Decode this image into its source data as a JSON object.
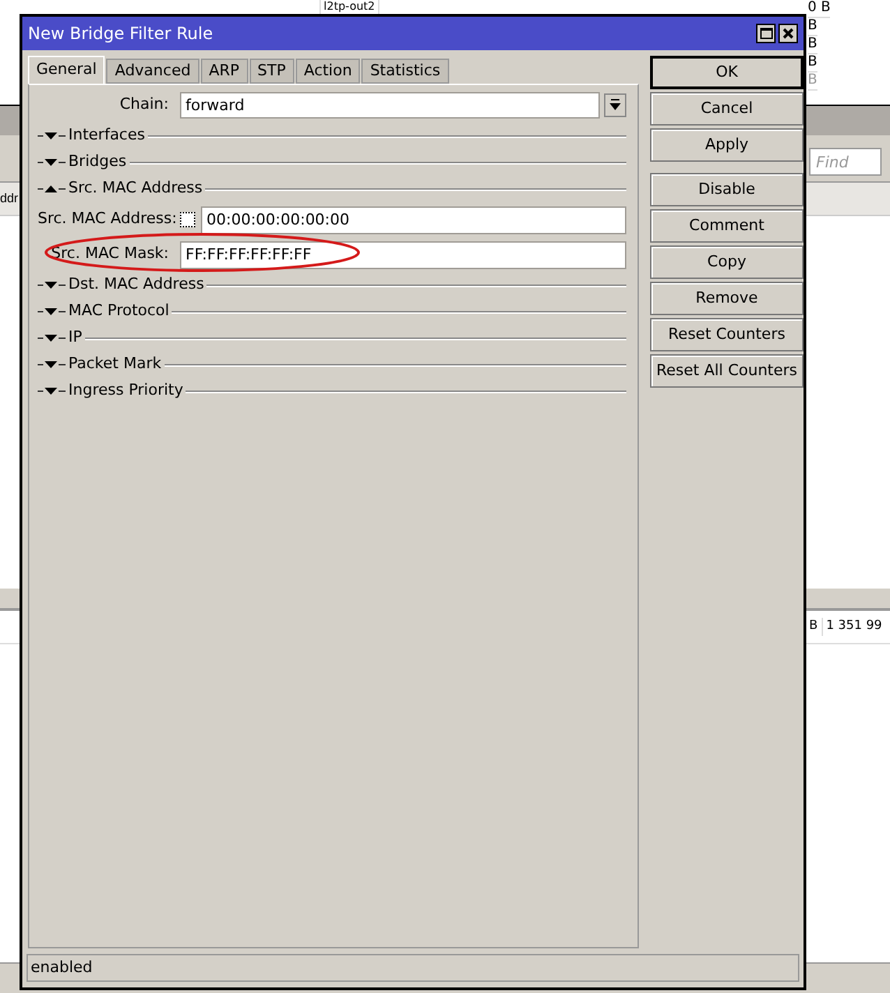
{
  "background": {
    "top_cell": "l2tp-out2",
    "sizes": [
      {
        "text": "0 B",
        "disabled": false
      },
      {
        "text": "B",
        "disabled": false
      },
      {
        "text": "B",
        "disabled": false
      },
      {
        "text": "B",
        "disabled": false
      },
      {
        "text": "B",
        "disabled": true
      }
    ],
    "find": {
      "placeholder": "Find"
    },
    "header_cell": "ddr",
    "row_cells": [
      "B",
      "1 351 99"
    ]
  },
  "dialog": {
    "title": "New Bridge Filter Rule",
    "tabs": [
      {
        "label": "General",
        "selected": true
      },
      {
        "label": "Advanced",
        "selected": false
      },
      {
        "label": "ARP",
        "selected": false
      },
      {
        "label": "STP",
        "selected": false
      },
      {
        "label": "Action",
        "selected": false
      },
      {
        "label": "Statistics",
        "selected": false
      }
    ],
    "chain": {
      "label": "Chain:",
      "value": "forward"
    },
    "sections": [
      {
        "label": "Interfaces",
        "expanded": false
      },
      {
        "label": "Bridges",
        "expanded": false
      },
      {
        "label": "Src. MAC Address",
        "expanded": true,
        "fields": [
          {
            "label": "Src. MAC Address:",
            "value": "00:00:00:00:00:00",
            "negate": false
          },
          {
            "label": "Src. MAC Mask:",
            "value": "FF:FF:FF:FF:FF:FF",
            "highlighted": true
          }
        ]
      },
      {
        "label": "Dst. MAC Address",
        "expanded": false
      },
      {
        "label": "MAC Protocol",
        "expanded": false
      },
      {
        "label": "IP",
        "expanded": false
      },
      {
        "label": "Packet Mark",
        "expanded": false
      },
      {
        "label": "Ingress Priority",
        "expanded": false
      }
    ],
    "button_groups": [
      [
        {
          "label": "OK",
          "default": true
        },
        {
          "label": "Cancel",
          "default": false
        },
        {
          "label": "Apply",
          "default": false
        }
      ],
      [
        {
          "label": "Disable",
          "default": false
        },
        {
          "label": "Comment",
          "default": false
        },
        {
          "label": "Copy",
          "default": false
        },
        {
          "label": "Remove",
          "default": false
        },
        {
          "label": "Reset Counters",
          "default": false
        },
        {
          "label": "Reset All Counters",
          "default": false
        }
      ]
    ],
    "status": "enabled"
  }
}
